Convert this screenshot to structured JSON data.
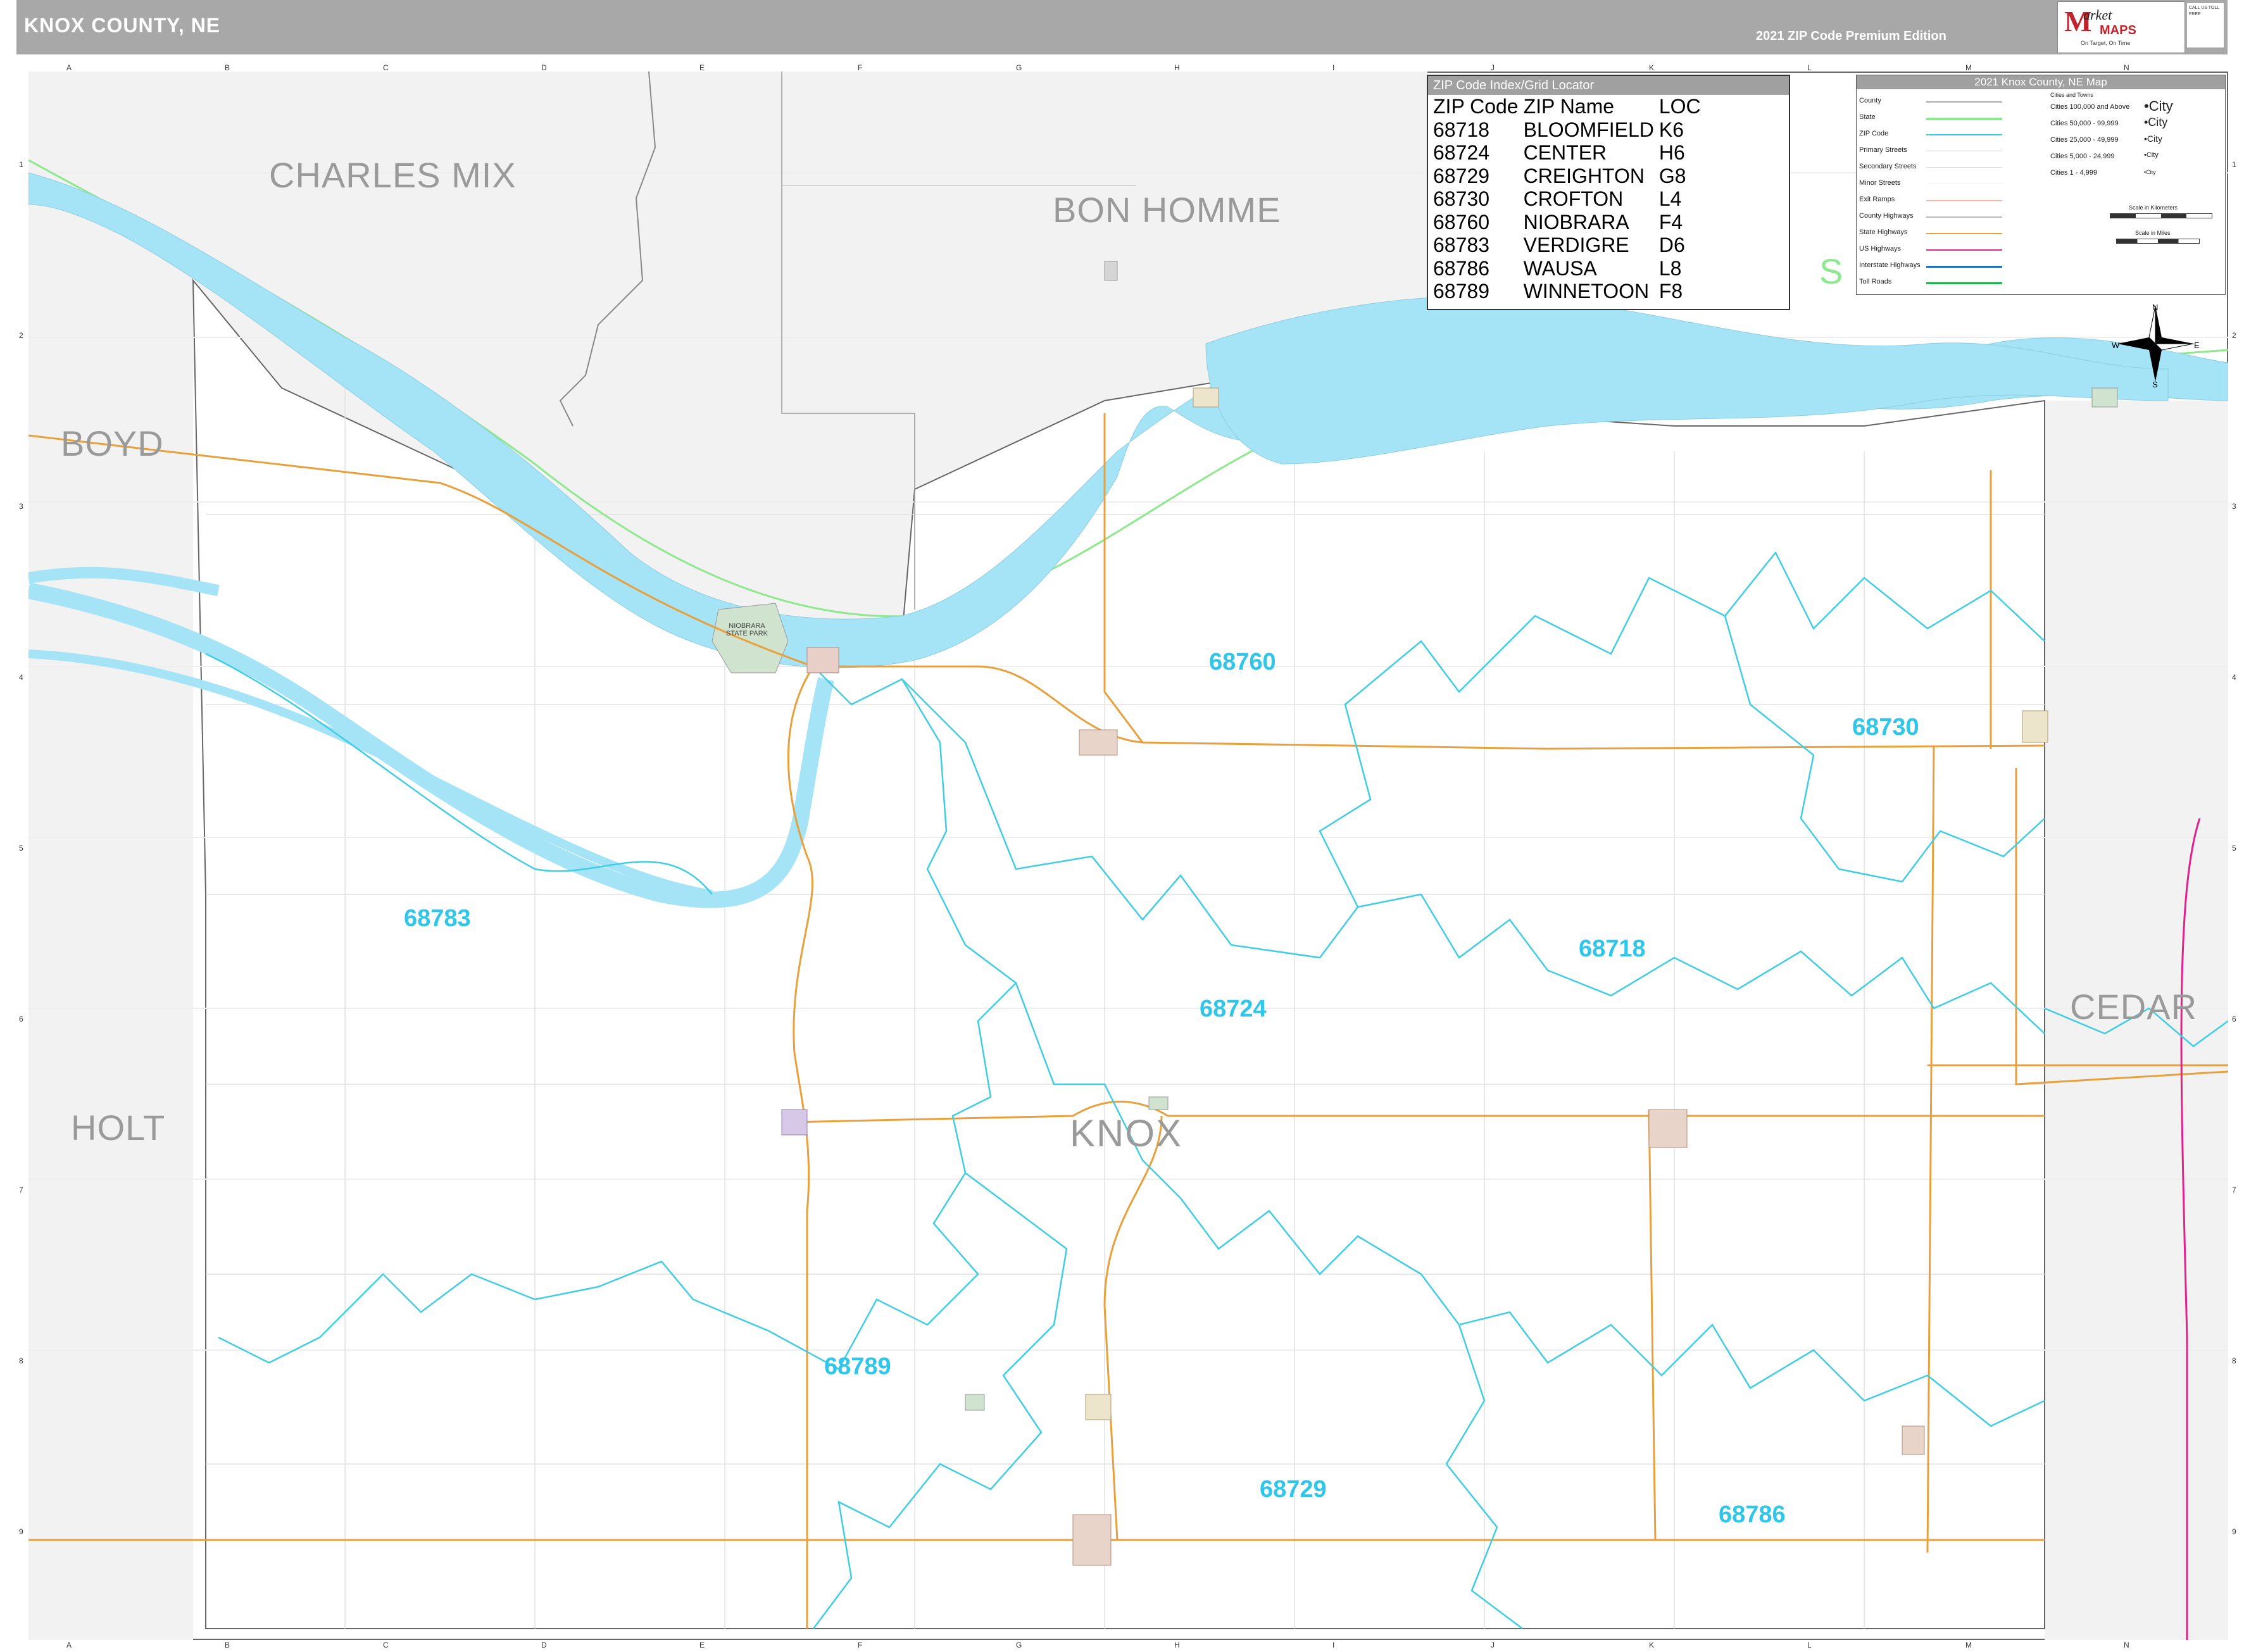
{
  "header": {
    "title": "KNOX COUNTY, NE",
    "edition": "2021 ZIP Code Premium Edition",
    "logo": {
      "m": "M",
      "market": "arket",
      "maps": "MAPS",
      "tagline": "On Target, On Time",
      "contact": "CALL US TOLL FREE"
    }
  },
  "grid": {
    "columns": [
      "A",
      "B",
      "C",
      "D",
      "E",
      "F",
      "G",
      "H",
      "I",
      "J",
      "K",
      "L",
      "M",
      "N"
    ],
    "rows": [
      "1",
      "2",
      "3",
      "4",
      "5",
      "6",
      "7",
      "8",
      "9"
    ]
  },
  "counties": {
    "charles_mix": "CHARLES MIX",
    "bon_homme": "BON HOMME",
    "boyd": "BOYD",
    "holt": "HOLT",
    "cedar": "CEDAR",
    "knox": "KNOX",
    "partial_s": "S"
  },
  "zip_labels": {
    "z68760": "68760",
    "z68730": "68730",
    "z68783": "68783",
    "z68718": "68718",
    "z68724": "68724",
    "z68789": "68789",
    "z68729": "68729",
    "z68786": "68786"
  },
  "places": {
    "niobrara_state_park": "NIOBRARA STATE PARK"
  },
  "zip_index": {
    "title": "ZIP Code Index/Grid Locator",
    "headers": {
      "zip": "ZIP Code",
      "name": "ZIP Name",
      "loc": "LOC"
    },
    "rows": [
      {
        "zip": "68718",
        "name": "BLOOMFIELD",
        "loc": "K6"
      },
      {
        "zip": "68724",
        "name": "CENTER",
        "loc": "H6"
      },
      {
        "zip": "68729",
        "name": "CREIGHTON",
        "loc": "G8"
      },
      {
        "zip": "68730",
        "name": "CROFTON",
        "loc": "L4"
      },
      {
        "zip": "68760",
        "name": "NIOBRARA",
        "loc": "F4"
      },
      {
        "zip": "68783",
        "name": "VERDIGRE",
        "loc": "D6"
      },
      {
        "zip": "68786",
        "name": "WAUSA",
        "loc": "L8"
      },
      {
        "zip": "68789",
        "name": "WINNETOON",
        "loc": "F8"
      }
    ]
  },
  "legend": {
    "title": "2021 Knox County, NE Map",
    "items": [
      "County",
      "State",
      "ZIP Code",
      "Primary Streets",
      "Secondary Streets",
      "Minor Streets",
      "Exit Ramps",
      "County Highways",
      "State Highways",
      "US Highways",
      "Interstate Highways",
      "Toll Roads"
    ],
    "cities_heading": "Cities and Towns",
    "cities": [
      {
        "label": "Cities 100,000 and Above",
        "sample": "•City"
      },
      {
        "label": "Cities 50,000 - 99,999",
        "sample": "•City"
      },
      {
        "label": "Cities 25,000 - 49,999",
        "sample": "•City"
      },
      {
        "label": "Cities 5,000 - 24,999",
        "sample": "•City"
      },
      {
        "label": "Cities 1 - 4,999",
        "sample": "•City"
      }
    ],
    "scale_km": "Scale in Kilometers",
    "scale_mi": "Scale in Miles",
    "compass": {
      "n": "N",
      "s": "S",
      "e": "E",
      "w": "W"
    }
  },
  "colors": {
    "water": "#a5e4f7",
    "zip_line": "#3fcde6",
    "state_highway": "#e8a03c",
    "county_fill_outside": "#f2f2f2",
    "zip_label": "#2fc6ea",
    "state_line": "#8ee88e",
    "us_highway": "#e0228c"
  }
}
